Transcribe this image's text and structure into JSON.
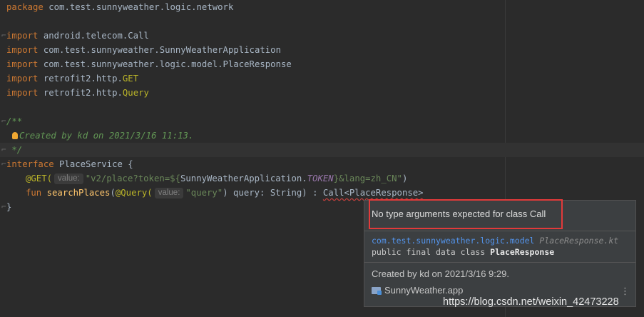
{
  "code": {
    "package_kw": "package",
    "package_name": " com.test.sunnyweather.logic.network",
    "import_kw": "import",
    "imports": [
      " android.telecom.Call",
      " com.test.sunnyweather.SunnyWeatherApplication",
      " com.test.sunnyweather.logic.model.PlaceResponse"
    ],
    "import_get_prefix": " retrofit2.http.",
    "import_get_name": "GET",
    "import_query_prefix": " retrofit2.http.",
    "import_query_name": "Query",
    "doc_open": "/**",
    "doc_created": "Created by kd on 2021/3/16 11:13.",
    "doc_close": " */",
    "interface_kw": "interface",
    "interface_name": " PlaceService {",
    "get_annotation": "@GET(",
    "hint_value": "value:",
    "get_value_str1": "\"v2/place?token=${",
    "get_value_app": "SunnyWeatherApplication.",
    "get_value_token": "TOKEN",
    "get_value_str2": "}&lang=zh_CN\"",
    "get_close": ")",
    "fun_kw": "fun",
    "fun_name": "searchPlaces",
    "fun_open": "(",
    "query_annotation": "@Query(",
    "query_value": "\"query\"",
    "fun_params": ") query: String) : ",
    "return_type": "Call<PlaceResponse>",
    "closing_brace": "}"
  },
  "popup": {
    "error_message": "No type arguments expected for class Call",
    "package_name": "com.test.sunnyweather.logic.model",
    "file_name": "PlaceResponse.kt",
    "decl_prefix": "public final data class ",
    "decl_name": "PlaceResponse",
    "created_by": "Created by kd on 2021/3/16 9:29.",
    "module_name": "SunnyWeather.app",
    "menu_icon": "more-vertical-icon",
    "folder_icon": "module-folder-icon"
  },
  "watermark": "https://blog.csdn.net/weixin_42473228",
  "colors": {
    "background": "#2b2b2b",
    "keyword": "#cc7832",
    "string": "#6a8759",
    "comment": "#629755",
    "annotation": "#bbb529",
    "error_outline": "#e23a3a",
    "link": "#5394ec"
  }
}
